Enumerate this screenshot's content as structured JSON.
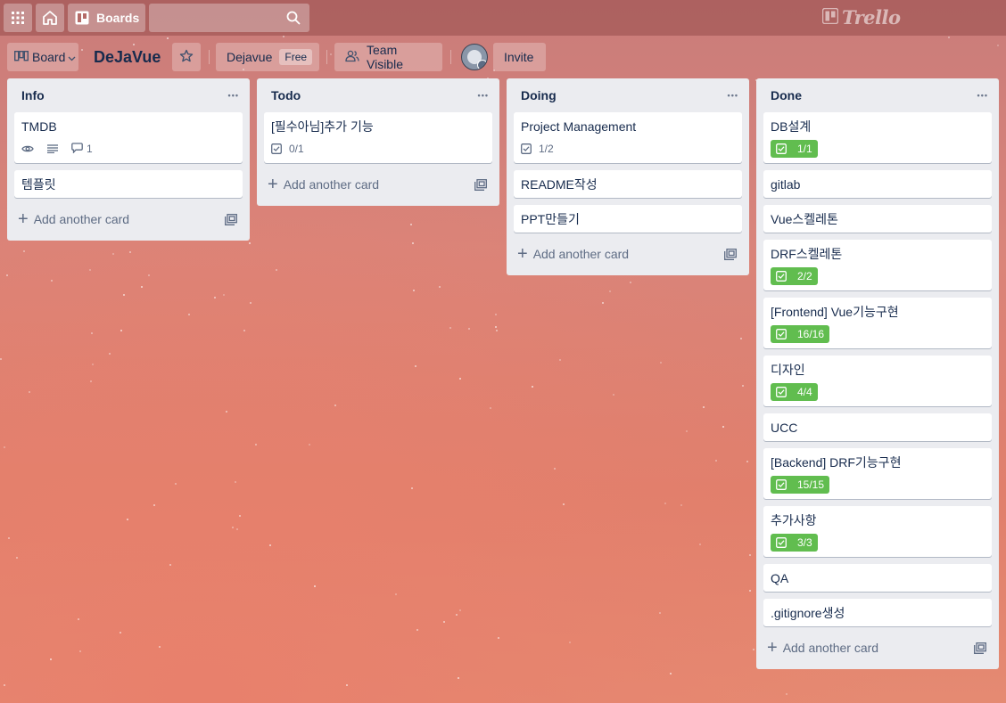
{
  "header": {
    "apps_icon": "grid-icon",
    "home_icon": "home-icon",
    "boards_label": "Boards",
    "search_placeholder": "",
    "logo_text": "Trello"
  },
  "board": {
    "view_label": "Board",
    "title": "DeJaVue",
    "workspace": "Dejavue",
    "workspace_badge": "Free",
    "visibility": "Team Visible",
    "invite": "Invite"
  },
  "lists": [
    {
      "title": "Info",
      "cards": [
        {
          "title": "TMDB",
          "watch": true,
          "description": true,
          "comments": "1"
        },
        {
          "title": "템플릿"
        }
      ],
      "add_label": "Add another card"
    },
    {
      "title": "Todo",
      "cards": [
        {
          "title": "[필수아님]추가 기능",
          "checklist": "0/1"
        }
      ],
      "add_label": "Add another card"
    },
    {
      "title": "Doing",
      "cards": [
        {
          "title": "Project Management",
          "checklist": "1/2"
        },
        {
          "title": "README작성"
        },
        {
          "title": "PPT만들기"
        }
      ],
      "add_label": "Add another card"
    },
    {
      "title": "Done",
      "cards": [
        {
          "title": "DB설계",
          "checklist_done": "1/1"
        },
        {
          "title": "gitlab"
        },
        {
          "title": "Vue스켈레톤"
        },
        {
          "title": "DRF스켈레톤",
          "checklist_done": "2/2"
        },
        {
          "title": "[Frontend] Vue기능구현",
          "checklist_done": "16/16"
        },
        {
          "title": "디자인",
          "checklist_done": "4/4"
        },
        {
          "title": "UCC"
        },
        {
          "title": "[Backend] DRF기능구현",
          "checklist_done": "15/15"
        },
        {
          "title": "추가사항",
          "checklist_done": "3/3"
        },
        {
          "title": "QA"
        },
        {
          "title": ".gitignore생성"
        }
      ],
      "add_label": "Add another card"
    }
  ],
  "colors": {
    "list_bg": "#ebecf0",
    "checklist_complete": "#61bd4f",
    "text": "#172b4d"
  }
}
